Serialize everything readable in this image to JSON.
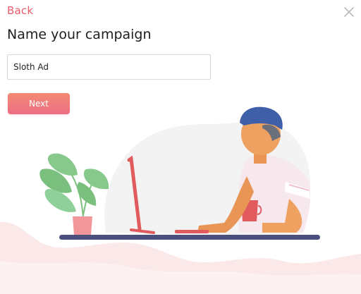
{
  "dialog": {
    "back_label": "Back",
    "title": "Name your campaign",
    "campaign_name_value": "Sloth Ad",
    "next_label": "Next"
  },
  "icons": {
    "close": "close-icon"
  },
  "colors": {
    "accent": "#ec5a6a",
    "button_gradient_top": "#f38b73",
    "button_gradient_bottom": "#ee6d86"
  }
}
